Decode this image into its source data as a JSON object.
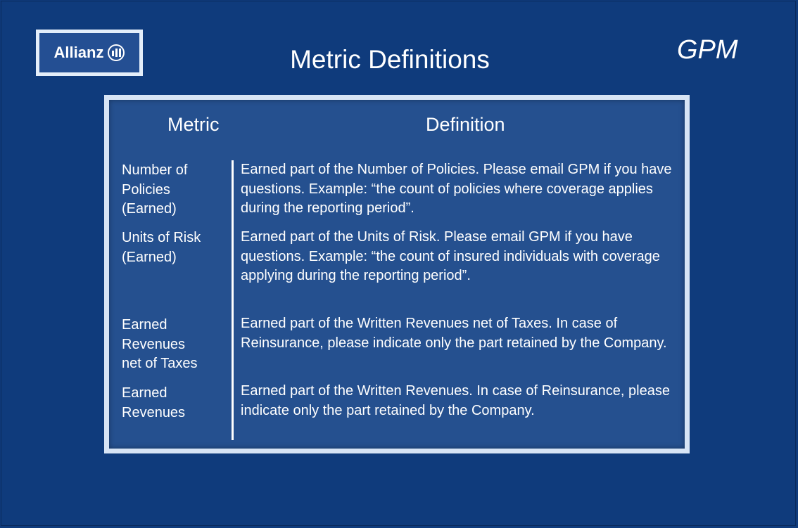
{
  "logo": {
    "text": "Allianz"
  },
  "title": "Metric Definitions",
  "corner_label": "GPM",
  "table": {
    "headers": {
      "metric": "Metric",
      "definition": "Definition"
    },
    "rows": [
      {
        "metric": "Number of Policies (Earned)",
        "definition": "Earned part of the Number of Policies. Please email GPM if you have questions. Example: “the count of policies where coverage applies during the reporting period”."
      },
      {
        "metric": "Units of Risk (Earned)",
        "definition": "Earned part of the Units of Risk. Please email GPM if you have questions. Example: “the count of insured individuals with coverage applying during the reporting period”."
      },
      {
        "metric": "Earned Revenues net of Taxes",
        "definition": "Earned part of the Written Revenues net of Taxes. In case of Reinsurance, please indicate only the part retained by the Company."
      },
      {
        "metric": "Earned Revenues",
        "definition": "Earned part of the Written Revenues. In case of Reinsurance, please indicate only the part retained by the Company."
      }
    ]
  }
}
